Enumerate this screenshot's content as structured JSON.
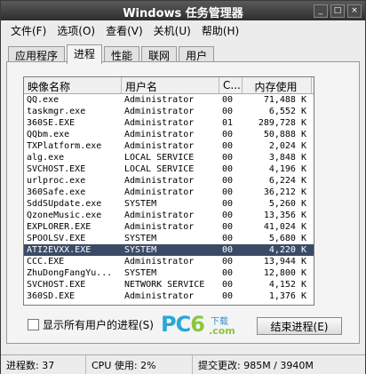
{
  "window": {
    "title": "Windows 任务管理器"
  },
  "title_buttons": {
    "minimize": "_",
    "maximize": "□",
    "close": "×"
  },
  "menu": [
    "文件(F)",
    "选项(O)",
    "查看(V)",
    "关机(U)",
    "帮助(H)"
  ],
  "tabs": [
    "应用程序",
    "进程",
    "性能",
    "联网",
    "用户"
  ],
  "active_tab": "进程",
  "table": {
    "headers": [
      "映像名称",
      "用户名",
      "C...",
      "内存使用"
    ],
    "rows": [
      [
        "QQ.exe",
        "Administrator",
        "00",
        "71,488 K"
      ],
      [
        "taskmgr.exe",
        "Administrator",
        "00",
        "6,552 K"
      ],
      [
        "360SE.EXE",
        "Administrator",
        "01",
        "289,728 K"
      ],
      [
        "QQbm.exe",
        "Administrator",
        "00",
        "50,888 K"
      ],
      [
        "TXPlatform.exe",
        "Administrator",
        "00",
        "2,024 K"
      ],
      [
        "alg.exe",
        "LOCAL SERVICE",
        "00",
        "3,848 K"
      ],
      [
        "SVCHOST.EXE",
        "LOCAL SERVICE",
        "00",
        "4,196 K"
      ],
      [
        "urlproc.exe",
        "Administrator",
        "00",
        "6,224 K"
      ],
      [
        "360Safe.exe",
        "Administrator",
        "00",
        "36,212 K"
      ],
      [
        "SddSUpdate.exe",
        "SYSTEM",
        "00",
        "5,260 K"
      ],
      [
        "QzoneMusic.exe",
        "Administrator",
        "00",
        "13,356 K"
      ],
      [
        "EXPLORER.EXE",
        "Administrator",
        "00",
        "41,024 K"
      ],
      [
        "SPOOLSV.EXE",
        "SYSTEM",
        "00",
        "5,680 K"
      ],
      [
        "ATI2EVXX.EXE",
        "SYSTEM",
        "00",
        "4,220 K"
      ],
      [
        "CCC.EXE",
        "Administrator",
        "00",
        "13,944 K"
      ],
      [
        "ZhuDongFangYu...",
        "SYSTEM",
        "00",
        "12,800 K"
      ],
      [
        "SVCHOST.EXE",
        "NETWORK SERVICE",
        "00",
        "4,152 K"
      ],
      [
        "360SD.EXE",
        "Administrator",
        "00",
        "1,376 K"
      ]
    ],
    "selected_row": 13
  },
  "show_all_label": "显示所有用户的进程(S)",
  "end_process_label": "结束进程(E)",
  "logo": {
    "pc": "PC",
    "six": "6",
    "xz": "下载",
    "com": ".com"
  },
  "status": {
    "processes": "进程数: 37",
    "cpu": "CPU 使用: 2%",
    "commit": "提交更改: 985M / 3940M"
  }
}
